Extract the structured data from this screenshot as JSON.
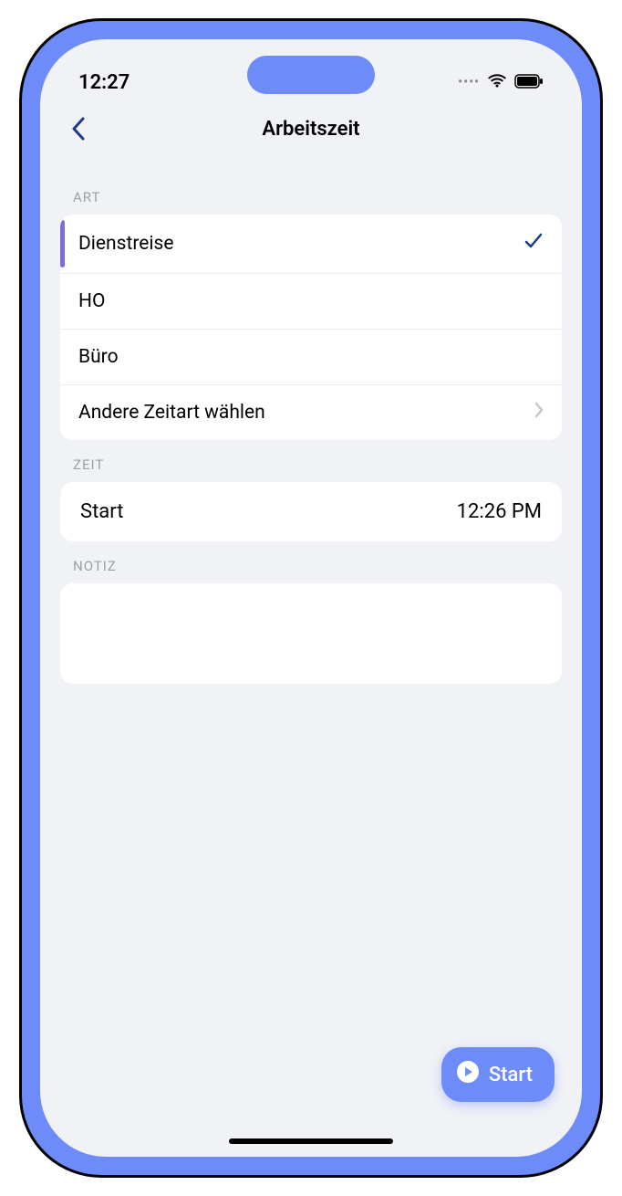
{
  "status": {
    "time": "12:27"
  },
  "header": {
    "title": "Arbeitszeit"
  },
  "sections": {
    "art": {
      "label": "ART",
      "items": [
        {
          "label": "Dienstreise",
          "selected": true
        },
        {
          "label": "HO",
          "selected": false
        },
        {
          "label": "Büro",
          "selected": false
        }
      ],
      "other_label": "Andere Zeitart wählen"
    },
    "zeit": {
      "label": "ZEIT",
      "start_label": "Start",
      "start_value": "12:26 PM"
    },
    "notiz": {
      "label": "NOTIZ"
    }
  },
  "fab": {
    "label": "Start"
  }
}
